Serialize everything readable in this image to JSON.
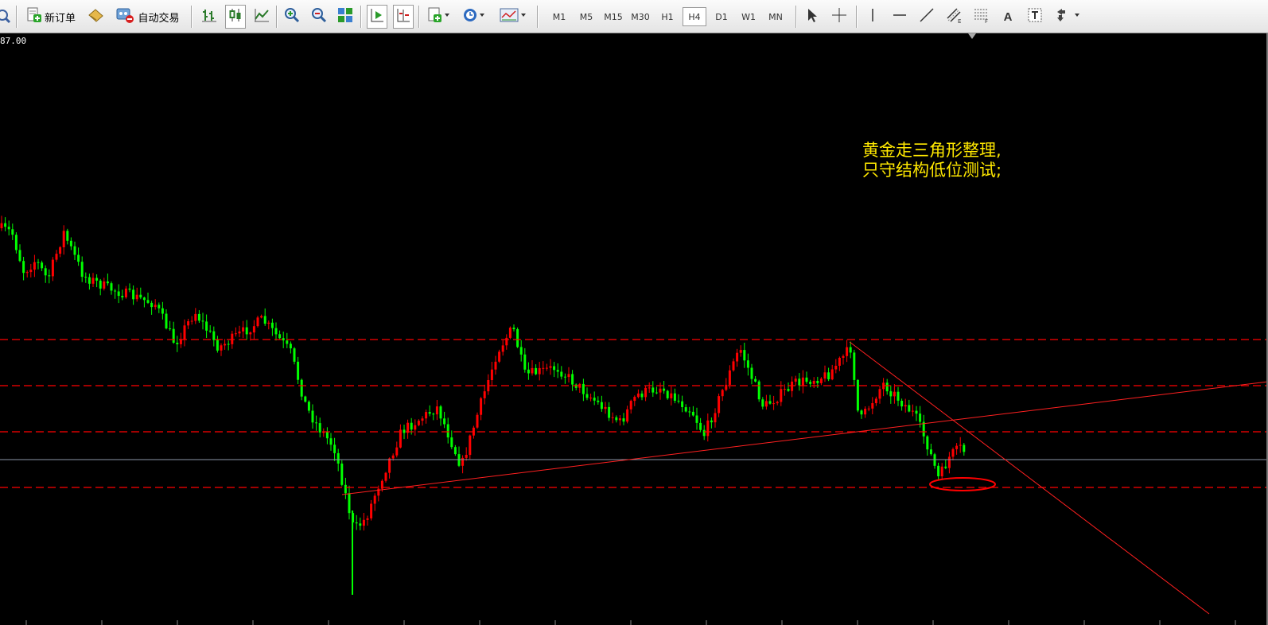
{
  "toolbar": {
    "new_order_label": "新订单",
    "auto_trading_label": "自动交易",
    "timeframes": [
      "M1",
      "M5",
      "M15",
      "M30",
      "H1",
      "H4",
      "D1",
      "W1",
      "MN"
    ],
    "active_timeframe": "H4",
    "text_tool_label": "A",
    "icons": [
      "zoom-icon",
      "new-order-icon",
      "expert-advisor-icon",
      "auto-trading-icon",
      "bar-chart-icon",
      "candlestick-icon",
      "line-chart-icon",
      "zoom-in-icon",
      "zoom-out-icon",
      "tile-windows-icon",
      "auto-scroll-icon",
      "chart-shift-icon",
      "indicators-icon",
      "periods-icon",
      "templates-icon",
      "cursor-icon",
      "crosshair-icon",
      "vertical-line-icon",
      "horizontal-line-icon",
      "trendline-icon",
      "equidistant-channel-icon",
      "fibonacci-icon",
      "text-icon",
      "text-label-icon",
      "arrows-icon"
    ]
  },
  "chart": {
    "price_label": "87.00",
    "annotation": "黄金走三角形整理,\n只守结构低位测试;",
    "colors": {
      "background": "#000000",
      "bull": "#ff0000",
      "bear": "#00ff00",
      "level": "#ff0000",
      "trendline": "#ff2020",
      "annotation": "#ffe800",
      "bid_line": "#8c96a8"
    }
  }
}
